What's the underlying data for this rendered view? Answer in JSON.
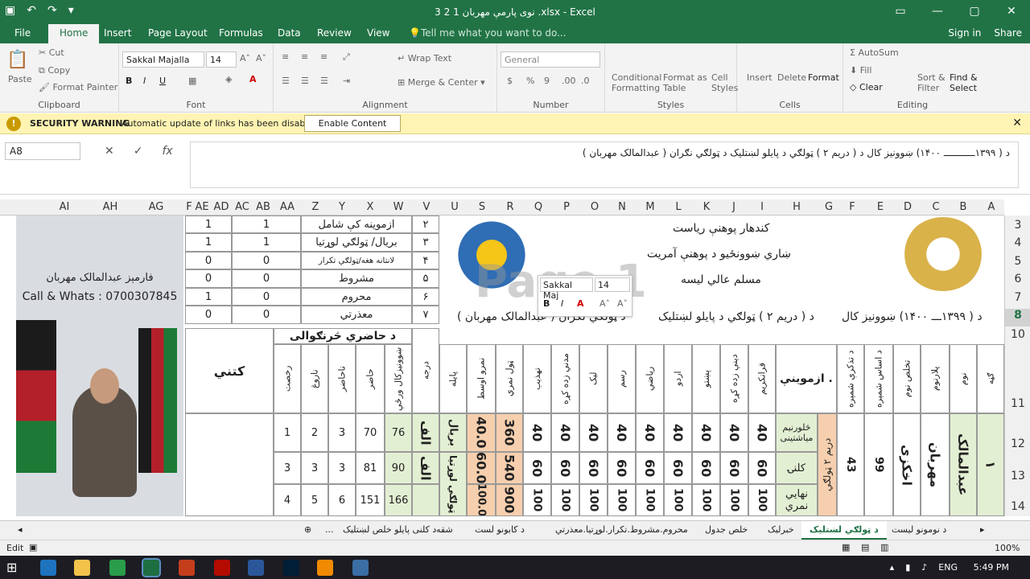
{
  "window": {
    "title": "نوی پارمې مهربان 1  2  3 .xlsx - Excel",
    "controls": {
      "restore": "▭",
      "minimize": "—",
      "maximize": "▢",
      "close": "✕"
    }
  },
  "qat": {
    "save": "▣",
    "undo": "↶",
    "redo": "↷",
    "more": "▾"
  },
  "ribbon_tabs": [
    "File",
    "Home",
    "Insert",
    "Page Layout",
    "Formulas",
    "Data",
    "Review",
    "View"
  ],
  "tell_me": "Tell me what you want to do...",
  "account": {
    "sign_in": "Sign in",
    "share": "Share"
  },
  "ribbon": {
    "clipboard": {
      "paste": "Paste",
      "cut": "Cut",
      "copy": "Copy",
      "format_painter": "Format Painter",
      "group": "Clipboard"
    },
    "font": {
      "name": "Sakkal Majalla",
      "size": "14",
      "bold": "B",
      "italic": "I",
      "underline": "U",
      "grow": "A˄",
      "shrink": "A˅",
      "color": "A",
      "group": "Font"
    },
    "alignment": {
      "wrap": "Wrap Text",
      "merge": "Merge & Center",
      "group": "Alignment"
    },
    "number": {
      "format": "General",
      "currency": "$",
      "percent": "%",
      "comma": "9",
      "inc_dec": ".00",
      "dec_dec": ".0",
      "group": "Number"
    },
    "styles": {
      "conditional": "Conditional",
      "conditional2": "Formatting",
      "format_as": "Format as",
      "format_as2": "Table",
      "cell": "Cell",
      "cell2": "Styles",
      "group": "Styles"
    },
    "cells": {
      "insert": "Insert",
      "delete": "Delete",
      "format": "Format",
      "group": "Cells"
    },
    "editing": {
      "autosum": "AutoSum",
      "fill": "Fill",
      "clear": "Clear",
      "sort": "Sort &",
      "sort2": "Filter",
      "find": "Find &",
      "find2": "Select",
      "group": "Editing"
    }
  },
  "security": {
    "title": "SECURITY WARNING",
    "message": "Automatic update of links has been disabled",
    "button": "Enable Content",
    "icon": "!"
  },
  "formula_bar": {
    "name_box": "A8",
    "fx": "fx",
    "content": "د ( ۱۳۹۹ـــــــــــ ۱۴۰۰) ښوونيز كال         د ( دريم ۲ ) ټولګي د پايلو لښتليک         د ټولګي نګران ( عبدالمالک مهربان )"
  },
  "columns": [
    "AI",
    "AH",
    "AG",
    "F",
    "AE",
    "AD",
    "AC",
    "AB",
    "AA",
    "Z",
    "Y",
    "X",
    "W",
    "V",
    "U",
    "S",
    "R",
    "Q",
    "P",
    "O",
    "N",
    "M",
    "L",
    "K",
    "J",
    "I",
    "H",
    "G",
    "F",
    "E",
    "D",
    "C",
    "B",
    "A"
  ],
  "rows": [
    "3",
    "4",
    "5",
    "6",
    "7",
    "8",
    "10",
    "11",
    "12",
    "13",
    "14"
  ],
  "photo": {
    "caption_name": "فارمېز عبدالمالک مهربان",
    "caption_phone": "Call & Whats : 0700307845"
  },
  "summary_table": [
    {
      "num": "۲",
      "label": "ازموينه كې شامل",
      "ab": "1",
      "f": "1"
    },
    {
      "num": "۳",
      "label": "بریال/ ټولګي لوړتیا",
      "ab": "1",
      "f": "1"
    },
    {
      "num": "۴",
      "label": "لانتانه هغه/ټولګي تکرار",
      "ab": "0",
      "f": "0"
    },
    {
      "num": "۵",
      "label": "مشروط",
      "ab": "0",
      "f": "0"
    },
    {
      "num": "۶",
      "label": "محروم",
      "ab": "0",
      "f": "1"
    },
    {
      "num": "۷",
      "label": "معذرتي",
      "ab": "0",
      "f": "0"
    }
  ],
  "header_block": {
    "line1": "كندهار پوهنې رياست",
    "line2": "ښاري ښوونځيو د پوهنې آمريت",
    "line3": "مسلم عالي ليسه",
    "year": "د ( ۱۳۹۹ـــ ۱۴۰۰) ښوونيز كال",
    "class": "د ( دريم ۲ ) ټولګي د پايلو لښتليک",
    "supervisor": "د ټولګي نګران ( عبدالمالک مهربان )"
  },
  "headers": {
    "attendance": "د حاضري څرنګوالی",
    "notes": "كتني",
    "exams": "ازموینې .",
    "school_year_days": "ښوونيزكال ورځې",
    "present": "حاضر",
    "absent": "ناحاضر",
    "sick": "ناروغ",
    "leave": "رخصت",
    "grade": "درجه",
    "result": "پایله",
    "average": "نمرو اوسط",
    "total": "ټول نمري",
    "subjects": [
      "قرانكريم",
      "دينې زده كړه",
      "پښتو",
      "اردو",
      "رياضي",
      "رسم",
      "ليک",
      "مدني زده کړه",
      "تهذيب"
    ],
    "name": "نوم",
    "father": "پلارنوم",
    "family": "تخلص نوم",
    "asas": "د اساس شمېره",
    "tazkira": "د تذکرې شمېره",
    "num": "ګڼه"
  },
  "student": {
    "num": "۱",
    "name": "عبدالمالک",
    "father": "مهربان",
    "family": "اخکزی",
    "asas": "99",
    "tazkira": "43",
    "class": "دريم ۲ ټولګي",
    "rows": [
      {
        "exam": "څلورنیم میاشتینی",
        "subjects": [
          "40",
          "40",
          "40",
          "40",
          "40",
          "40",
          "40",
          "40",
          "40"
        ],
        "total": "360",
        "average": "40.0",
        "result": "بریال",
        "grade": "الف",
        "days": "76",
        "present": "70",
        "absent": "3",
        "sick": "2",
        "leave": "1"
      },
      {
        "exam": "كلنۍ",
        "subjects": [
          "60",
          "60",
          "60",
          "60",
          "60",
          "60",
          "60",
          "60",
          "60"
        ],
        "total": "540",
        "average": "60.0",
        "result": "ټولګي لوړتیا",
        "grade": "الف",
        "days": "90",
        "present": "81",
        "absent": "3",
        "sick": "3",
        "leave": "3"
      },
      {
        "exam": "نهايي نمري",
        "subjects": [
          "100",
          "100",
          "100",
          "100",
          "100",
          "100",
          "100",
          "100",
          "100"
        ],
        "total": "900",
        "average": "100.0",
        "days": "166",
        "present": "151",
        "absent": "6",
        "sick": "5",
        "leave": "4"
      }
    ]
  },
  "watermark": "Page 1",
  "mini_toolbar": {
    "font": "Sakkal Maj",
    "size": "14",
    "b": "B",
    "i": "I",
    "a": "A",
    "grow": "A˄",
    "shrink": "A˅"
  },
  "sheet_tabs": [
    "د نومونو لیست",
    "د ټولګي لښتليک",
    "خبرليک",
    "خلص جدول",
    "محروم.مشروط.تكرار.لوړتیا.معذرتي",
    "د کابونو لست",
    "شقه",
    "د کلنی پايلو خلص لښتليک",
    "..."
  ],
  "active_sheet": "د ټولګي لښتليک",
  "status": {
    "mode": "Edit",
    "zoom": "100%"
  },
  "taskbar": {
    "time": "5:49 PM",
    "lang": "ENG"
  }
}
